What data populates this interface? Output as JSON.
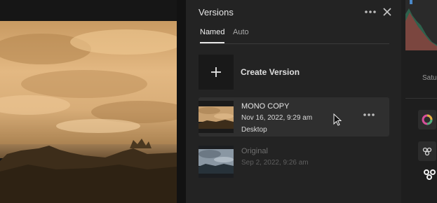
{
  "panel": {
    "title": "Versions",
    "tabs": [
      {
        "label": "Named",
        "active": true
      },
      {
        "label": "Auto",
        "active": false
      }
    ],
    "create_label": "Create Version",
    "versions": [
      {
        "name": "MONO COPY",
        "date": "Nov 16, 2022, 9:29 am",
        "device": "Desktop",
        "selected": true
      },
      {
        "name": "Original",
        "date": "Sep 2, 2022, 9:26 am",
        "selected": false
      }
    ]
  },
  "right_panel": {
    "partial_label": "Satu"
  },
  "icons": {
    "panel_menu": "more-horizontal-icon",
    "close": "close-icon",
    "create": "plus-icon",
    "card_menu": "more-horizontal-icon",
    "color": "color-wheel-icon",
    "effects": "effects-icon"
  },
  "colors": {
    "panel_bg": "#232323",
    "selected_card": "#2f2f2f",
    "sepia_light": "#e2b67d",
    "sepia_dark": "#3a2a18"
  }
}
